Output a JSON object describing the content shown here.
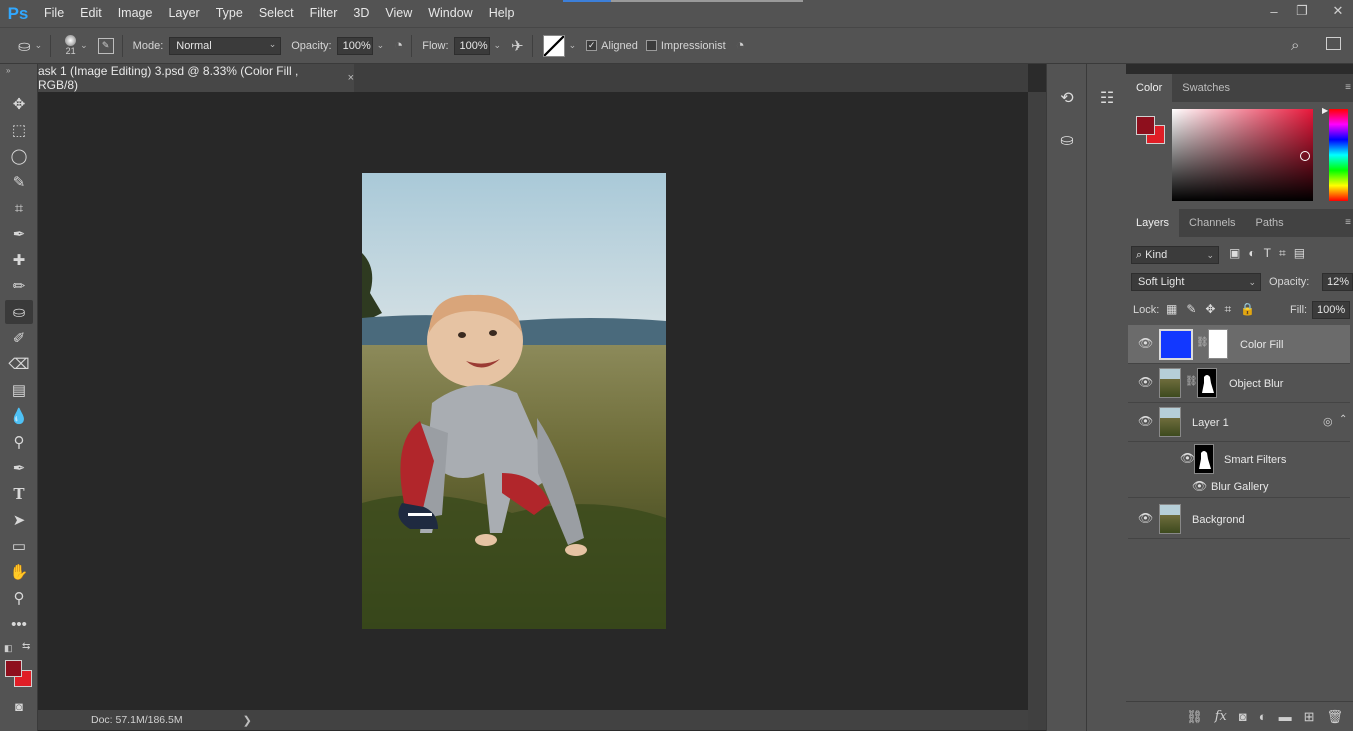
{
  "app": {
    "logo": "Ps",
    "menu": [
      "File",
      "Edit",
      "Image",
      "Layer",
      "Type",
      "Select",
      "Filter",
      "3D",
      "View",
      "Window",
      "Help"
    ],
    "window_controls": {
      "minimize": "–",
      "restore": "❐",
      "close": "✕"
    }
  },
  "options": {
    "brush_size": "21",
    "mode_label": "Mode:",
    "mode_value": "Normal",
    "opacity_label": "Opacity:",
    "opacity_value": "100%",
    "flow_label": "Flow:",
    "flow_value": "100%",
    "aligned_label": "Aligned",
    "aligned_checked": true,
    "impressionist_label": "Impressionist",
    "impressionist_checked": false
  },
  "document": {
    "tab_title": "ask 1 (Image Editing) 3.psd @ 8.33% (Color Fill , RGB/8)",
    "close": "×",
    "status": "Doc: 57.1M/186.5M",
    "status_arrow": "❯"
  },
  "colors": {
    "foreground": "#8e0f1d",
    "background": "#e01e26",
    "accent_blue": "#1238ff"
  },
  "color_panel": {
    "tabs": [
      "Color",
      "Swatches"
    ],
    "active_tab": "Color"
  },
  "layers_panel": {
    "tabs": [
      "Layers",
      "Channels",
      "Paths"
    ],
    "active_tab": "Layers",
    "kind_label": "Kind",
    "blend_mode": "Soft Light",
    "opacity_label": "Opacity:",
    "opacity_value": "12%",
    "lock_label": "Lock:",
    "fill_label": "Fill:",
    "fill_value": "100%",
    "layers": [
      {
        "name": "Color Fill",
        "selected": true
      },
      {
        "name": "Object Blur",
        "selected": false
      },
      {
        "name": "Layer 1",
        "selected": false
      },
      {
        "name": "Smart Filters",
        "selected": false
      },
      {
        "name": "Blur Gallery",
        "selected": false
      },
      {
        "name": "Backgrond",
        "selected": false
      }
    ]
  }
}
